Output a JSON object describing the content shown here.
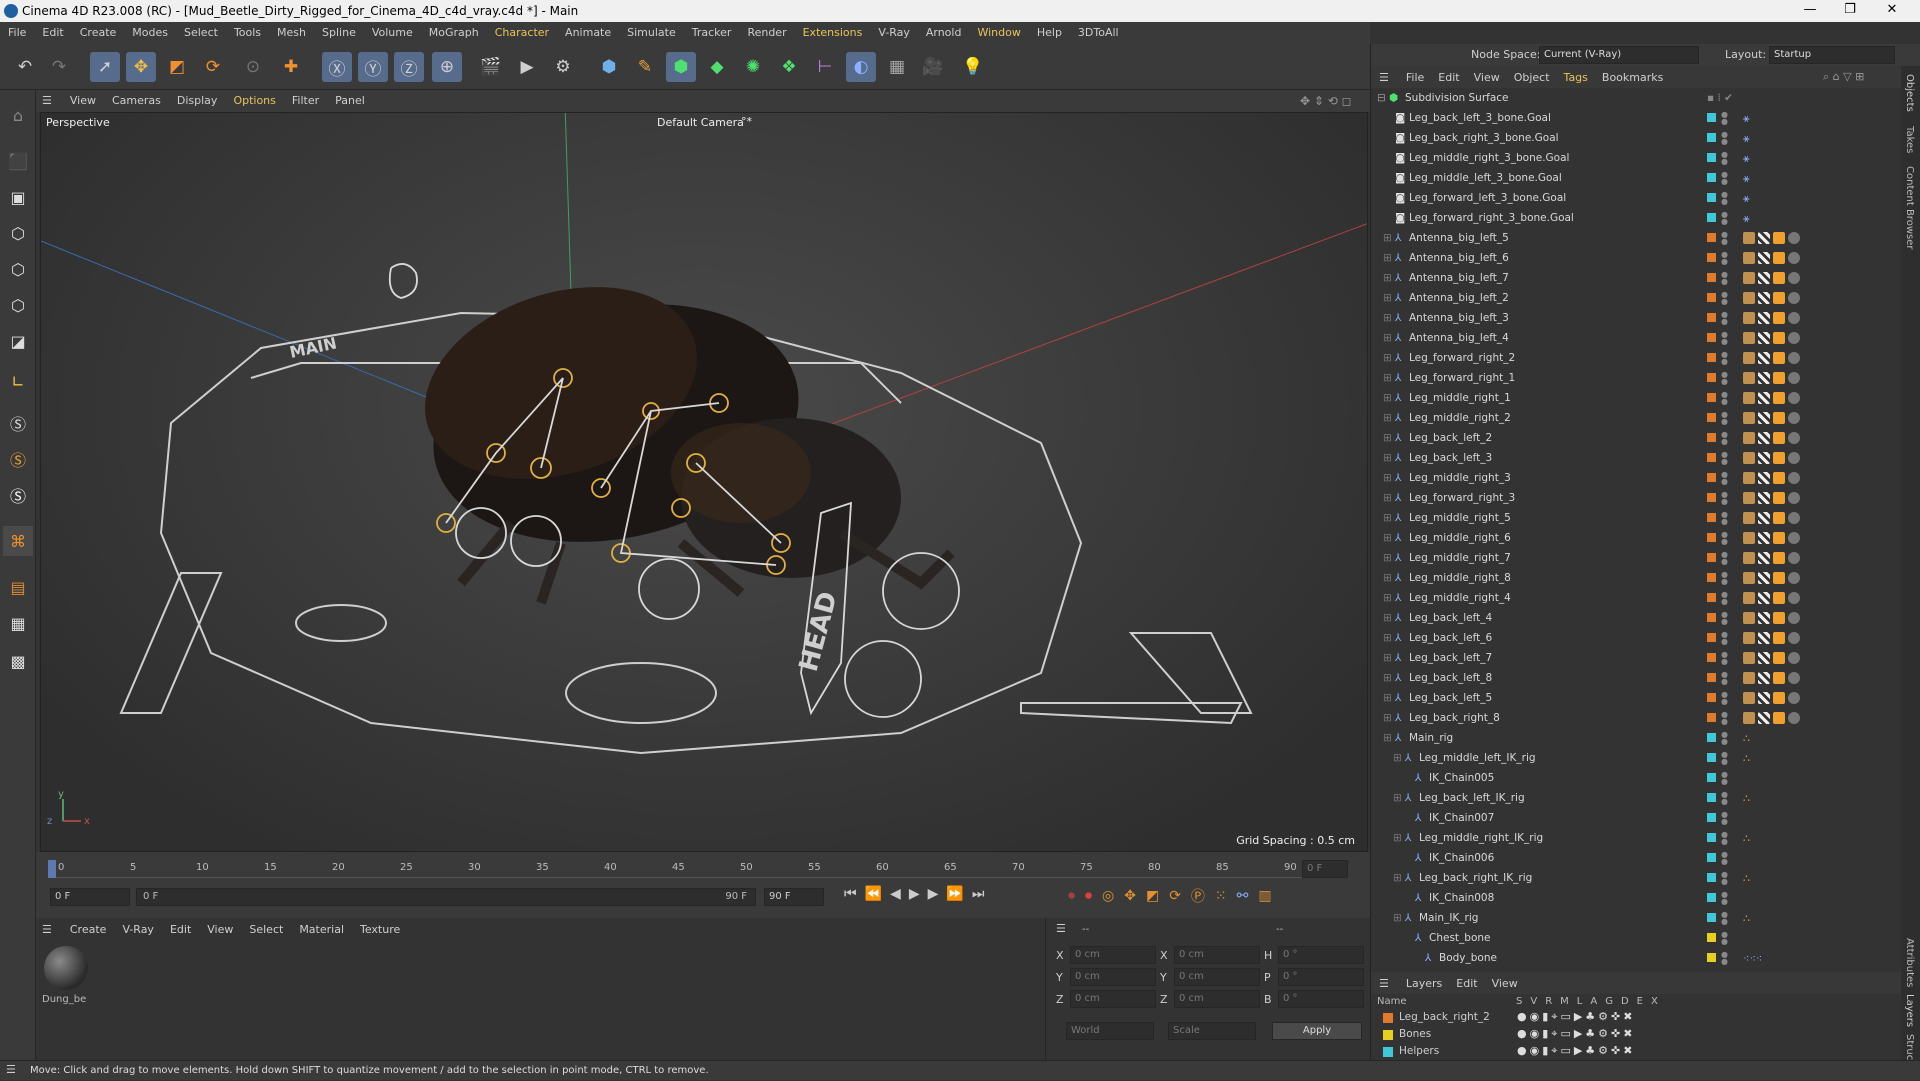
{
  "title": "Cinema 4D R23.008 (RC) - [Mud_Beetle_Dirty_Rigged_for_Cinema_4D_c4d_vray.c4d *] - Main",
  "window_controls": {
    "minimize": "—",
    "maximize": "❐",
    "close": "✕"
  },
  "menu": [
    "File",
    "Edit",
    "Create",
    "Modes",
    "Select",
    "Tools",
    "Mesh",
    "Spline",
    "Volume",
    "MoGraph",
    "Character",
    "Animate",
    "Simulate",
    "Tracker",
    "Render",
    "Extensions",
    "V-Ray",
    "Arnold",
    "Window",
    "Help",
    "3DToAll"
  ],
  "nodespace": {
    "label": "Node Space:",
    "value": "Current (V-Ray)"
  },
  "layout": {
    "label": "Layout:",
    "value": "Startup"
  },
  "viewport_menu": [
    "View",
    "Cameras",
    "Display",
    "Options",
    "Filter",
    "Panel"
  ],
  "viewport": {
    "name": "Perspective",
    "camera": "Default Camera",
    "camera_icon": "°*",
    "grid": "Grid Spacing : 0.5 cm",
    "rig_label_head": "HEAD",
    "rig_label_main": "MAIN"
  },
  "timeline": {
    "ticks": [
      "0",
      "5",
      "10",
      "15",
      "20",
      "25",
      "30",
      "35",
      "40",
      "45",
      "50",
      "55",
      "60",
      "65",
      "70",
      "75",
      "80",
      "85",
      "90"
    ],
    "frame_end_field": "0 F",
    "cur_frame": "0 F",
    "start_field": "0 F",
    "end_field": "90 F",
    "end_field2": "90 F"
  },
  "material_menu": [
    "Create",
    "V-Ray",
    "Edit",
    "View",
    "Select",
    "Material",
    "Texture"
  ],
  "material": {
    "name": "Dung_be"
  },
  "coords": {
    "header_left": "--",
    "header_right": "--",
    "rows": [
      {
        "a": "X",
        "v1": "0 cm",
        "b": "X",
        "v2": "0 cm",
        "c": "H",
        "v3": "0 °"
      },
      {
        "a": "Y",
        "v1": "0 cm",
        "b": "Y",
        "v2": "0 cm",
        "c": "P",
        "v3": "0 °"
      },
      {
        "a": "Z",
        "v1": "0 cm",
        "b": "Z",
        "v2": "0 cm",
        "c": "B",
        "v3": "0 °"
      }
    ],
    "world": "World",
    "scale": "Scale",
    "apply": "Apply"
  },
  "objects_menu": [
    "File",
    "Edit",
    "View",
    "Object",
    "Tags",
    "Bookmarks"
  ],
  "objects_root": "Subdivision Surface",
  "objects": [
    {
      "name": "Leg_back_left_3_bone.Goal",
      "d": 1,
      "c": "#3fc8d8",
      "t": "ik"
    },
    {
      "name": "Leg_back_right_3_bone.Goal",
      "d": 1,
      "c": "#3fc8d8",
      "t": "ik"
    },
    {
      "name": "Leg_middle_right_3_bone.Goal",
      "d": 1,
      "c": "#3fc8d8",
      "t": "ik"
    },
    {
      "name": "Leg_middle_left_3_bone.Goal",
      "d": 1,
      "c": "#3fc8d8",
      "t": "ik"
    },
    {
      "name": "Leg_forward_left_3_bone.Goal",
      "d": 1,
      "c": "#3fc8d8",
      "t": "ik"
    },
    {
      "name": "Leg_forward_right_3_bone.Goal",
      "d": 1,
      "c": "#3fc8d8",
      "t": "ik"
    },
    {
      "name": "Antenna_big_left_5",
      "d": 1,
      "c": "#e07a2c",
      "t": "mat"
    },
    {
      "name": "Antenna_big_left_6",
      "d": 1,
      "c": "#e07a2c",
      "t": "mat"
    },
    {
      "name": "Antenna_big_left_7",
      "d": 1,
      "c": "#e07a2c",
      "t": "mat"
    },
    {
      "name": "Antenna_big_left_2",
      "d": 1,
      "c": "#e07a2c",
      "t": "mat"
    },
    {
      "name": "Antenna_big_left_3",
      "d": 1,
      "c": "#e07a2c",
      "t": "mat"
    },
    {
      "name": "Antenna_big_left_4",
      "d": 1,
      "c": "#e07a2c",
      "t": "mat"
    },
    {
      "name": "Leg_forward_right_2",
      "d": 1,
      "c": "#e07a2c",
      "t": "mat"
    },
    {
      "name": "Leg_forward_right_1",
      "d": 1,
      "c": "#e07a2c",
      "t": "mat"
    },
    {
      "name": "Leg_middle_right_1",
      "d": 1,
      "c": "#e07a2c",
      "t": "mat"
    },
    {
      "name": "Leg_middle_right_2",
      "d": 1,
      "c": "#e07a2c",
      "t": "mat"
    },
    {
      "name": "Leg_back_left_2",
      "d": 1,
      "c": "#e07a2c",
      "t": "mat"
    },
    {
      "name": "Leg_back_left_3",
      "d": 1,
      "c": "#e07a2c",
      "t": "mat"
    },
    {
      "name": "Leg_middle_right_3",
      "d": 1,
      "c": "#e07a2c",
      "t": "mat"
    },
    {
      "name": "Leg_forward_right_3",
      "d": 1,
      "c": "#e07a2c",
      "t": "mat"
    },
    {
      "name": "Leg_middle_right_5",
      "d": 1,
      "c": "#e07a2c",
      "t": "mat"
    },
    {
      "name": "Leg_middle_right_6",
      "d": 1,
      "c": "#e07a2c",
      "t": "mat"
    },
    {
      "name": "Leg_middle_right_7",
      "d": 1,
      "c": "#e07a2c",
      "t": "mat"
    },
    {
      "name": "Leg_middle_right_8",
      "d": 1,
      "c": "#e07a2c",
      "t": "mat"
    },
    {
      "name": "Leg_middle_right_4",
      "d": 1,
      "c": "#e07a2c",
      "t": "mat"
    },
    {
      "name": "Leg_back_left_4",
      "d": 1,
      "c": "#e07a2c",
      "t": "mat"
    },
    {
      "name": "Leg_back_left_6",
      "d": 1,
      "c": "#e07a2c",
      "t": "mat"
    },
    {
      "name": "Leg_back_left_7",
      "d": 1,
      "c": "#e07a2c",
      "t": "mat"
    },
    {
      "name": "Leg_back_left_8",
      "d": 1,
      "c": "#e07a2c",
      "t": "mat"
    },
    {
      "name": "Leg_back_left_5",
      "d": 1,
      "c": "#e07a2c",
      "t": "mat"
    },
    {
      "name": "Leg_back_right_8",
      "d": 1,
      "c": "#e07a2c",
      "t": "mat"
    },
    {
      "name": "Main_rig",
      "d": 1,
      "c": "#3fc8d8",
      "t": "dot"
    },
    {
      "name": "Leg_middle_left_IK_rig",
      "d": 2,
      "c": "#3fc8d8",
      "t": "dot"
    },
    {
      "name": "IK_Chain005",
      "d": 3,
      "c": "#3fc8d8",
      "t": ""
    },
    {
      "name": "Leg_back_left_IK_rig",
      "d": 2,
      "c": "#3fc8d8",
      "t": "dot"
    },
    {
      "name": "IK_Chain007",
      "d": 3,
      "c": "#3fc8d8",
      "t": ""
    },
    {
      "name": "Leg_middle_right_IK_rig",
      "d": 2,
      "c": "#3fc8d8",
      "t": "dot"
    },
    {
      "name": "IK_Chain006",
      "d": 3,
      "c": "#3fc8d8",
      "t": ""
    },
    {
      "name": "Leg_back_right_IK_rig",
      "d": 2,
      "c": "#3fc8d8",
      "t": "dot"
    },
    {
      "name": "IK_Chain008",
      "d": 3,
      "c": "#3fc8d8",
      "t": ""
    },
    {
      "name": "Main_IK_rig",
      "d": 2,
      "c": "#3fc8d8",
      "t": "dot"
    },
    {
      "name": "Chest_bone",
      "d": 3,
      "c": "#e8d020",
      "t": ""
    },
    {
      "name": "Body_bone",
      "d": 4,
      "c": "#e8d020",
      "t": "bone"
    }
  ],
  "layers_menu": [
    "Layers",
    "Edit",
    "View"
  ],
  "layers_header": {
    "name": "Name",
    "cols": [
      "S",
      "V",
      "R",
      "M",
      "L",
      "A",
      "G",
      "D",
      "E",
      "X"
    ]
  },
  "layers": [
    {
      "name": "Leg_back_right_2",
      "c": "#e07a2c"
    },
    {
      "name": "Bones",
      "c": "#e8d020"
    },
    {
      "name": "Helpers",
      "c": "#3fc8d8"
    }
  ],
  "side_tabs": [
    "Objects",
    "Takes",
    "Content Browser"
  ],
  "side_tabs_bottom": [
    "Attributes",
    "Layers",
    "Structure"
  ],
  "status": "Move: Click and drag to move elements. Hold down SHIFT to quantize movement / add to the selection in point mode, CTRL to remove."
}
